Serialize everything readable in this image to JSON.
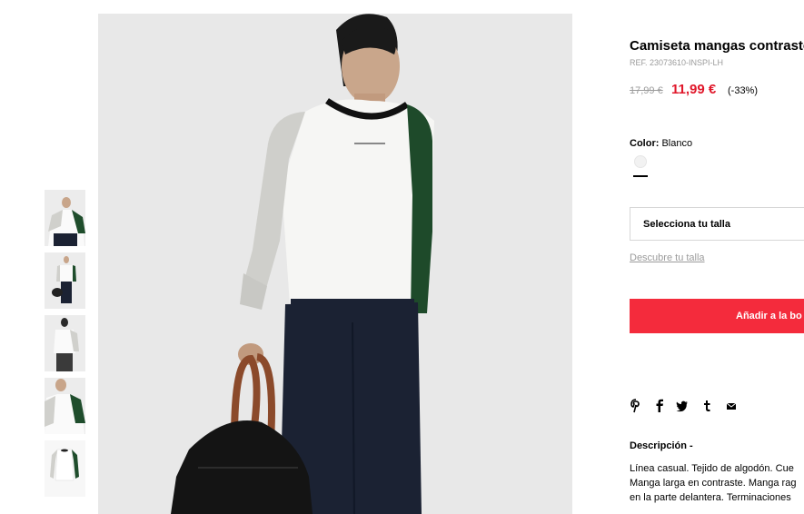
{
  "product": {
    "title": "Camiseta mangas contraste",
    "ref": "REF. 23073610-INSPI-LH",
    "old_price": "17,99 €",
    "new_price": "11,99 €",
    "discount": "(-33%)",
    "price_color": "#e0172a"
  },
  "color": {
    "label": "Color:",
    "value": "Blanco"
  },
  "size": {
    "select_label": "Selecciona tu talla",
    "guide_link": "Descubre tu talla"
  },
  "cart": {
    "button_label": "Añadir a la bo",
    "button_color": "#f42b3c"
  },
  "share": {
    "icons": [
      "pinterest-icon",
      "facebook-icon",
      "twitter-icon",
      "tumblr-icon",
      "email-icon"
    ]
  },
  "description": {
    "title": "Descripción -",
    "lines": [
      "Línea casual. Tejido de algodón. Cue",
      "Manga larga en contraste. Manga rag",
      "en la parte delantera. Terminaciones"
    ]
  },
  "gallery": {
    "thumbnail_count": 5
  }
}
